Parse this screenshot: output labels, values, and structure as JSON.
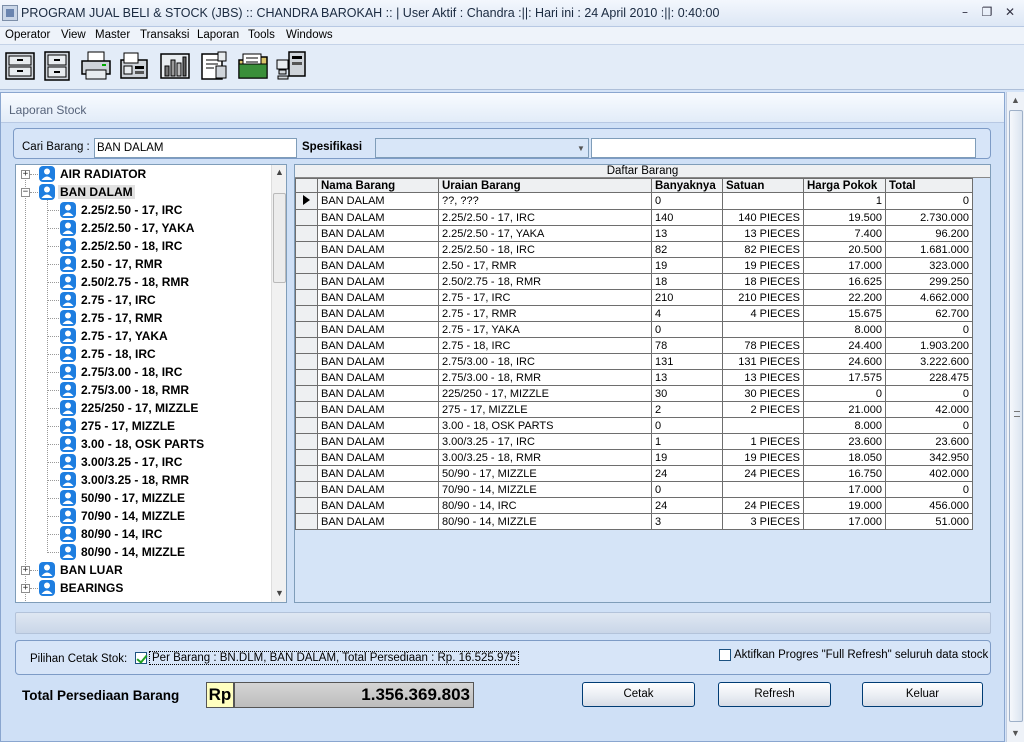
{
  "window": {
    "title": "PROGRAM JUAL BELI & STOCK (JBS) :: CHANDRA BAROKAH :: | User Aktif  : Chandra :||: Hari ini : 24 April 2010 :||: 0:40:00"
  },
  "menu": [
    {
      "label": "Operator"
    },
    {
      "label": "View"
    },
    {
      "label": "Master"
    },
    {
      "label": "Transaksi"
    },
    {
      "label": "Laporan"
    },
    {
      "label": "Tools"
    },
    {
      "label": "Windows"
    }
  ],
  "toolbar_icons": [
    "cabinet-icon",
    "cabinet-drawers-icon",
    "printer-icon",
    "fax-icon",
    "chart-icon",
    "report-icon",
    "folder-icon",
    "network-icon"
  ],
  "form": {
    "title": "Laporan Stock",
    "search_label": "Cari Barang :",
    "search_value": "BAN DALAM",
    "spec_label": "Spesifikasi",
    "spec_value": "",
    "spec_text": ""
  },
  "tree": {
    "root_items": [
      {
        "label": "AIR RADIATOR",
        "expanded": false
      },
      {
        "label": "BAN DALAM",
        "expanded": true,
        "selected": true
      },
      {
        "label": "BAN LUAR",
        "expanded": false
      },
      {
        "label": "BEARINGS",
        "expanded": false
      }
    ],
    "children": [
      "2.25/2.50 - 17, IRC",
      "2.25/2.50 - 17, YAKA",
      "2.25/2.50 - 18, IRC",
      "2.50 - 17, RMR",
      "2.50/2.75 - 18, RMR",
      "2.75 - 17, IRC",
      "2.75 - 17, RMR",
      "2.75 - 17, YAKA",
      "2.75 - 18, IRC",
      "2.75/3.00 - 18, IRC",
      "2.75/3.00 - 18, RMR",
      "225/250 - 17, MIZZLE",
      "275 - 17, MIZZLE",
      "3.00 - 18, OSK PARTS",
      "3.00/3.25 - 17, IRC",
      "3.00/3.25 - 18, RMR",
      "50/90 - 17, MIZZLE",
      "70/90 - 14, MIZZLE",
      "80/90 - 14, IRC",
      "80/90 - 14, MIZZLE"
    ]
  },
  "grid": {
    "caption": "Daftar Barang",
    "columns": [
      "Nama Barang",
      "Uraian Barang",
      "Banyaknya",
      "Satuan",
      "Harga Pokok",
      "Total"
    ],
    "rows": [
      [
        "BAN DALAM",
        "??, ???",
        "0",
        "",
        "1",
        "0"
      ],
      [
        "BAN DALAM",
        "2.25/2.50 - 17, IRC",
        "140",
        "140 PIECES",
        "19.500",
        "2.730.000"
      ],
      [
        "BAN DALAM",
        "2.25/2.50 - 17, YAKA",
        "13",
        "13 PIECES",
        "7.400",
        "96.200"
      ],
      [
        "BAN DALAM",
        "2.25/2.50 - 18, IRC",
        "82",
        "82 PIECES",
        "20.500",
        "1.681.000"
      ],
      [
        "BAN DALAM",
        "2.50 - 17, RMR",
        "19",
        "19 PIECES",
        "17.000",
        "323.000"
      ],
      [
        "BAN DALAM",
        "2.50/2.75 - 18, RMR",
        "18",
        "18 PIECES",
        "16.625",
        "299.250"
      ],
      [
        "BAN DALAM",
        "2.75 - 17, IRC",
        "210",
        "210 PIECES",
        "22.200",
        "4.662.000"
      ],
      [
        "BAN DALAM",
        "2.75 - 17, RMR",
        "4",
        "4 PIECES",
        "15.675",
        "62.700"
      ],
      [
        "BAN DALAM",
        "2.75 - 17, YAKA",
        "0",
        "",
        "8.000",
        "0"
      ],
      [
        "BAN DALAM",
        "2.75 - 18, IRC",
        "78",
        "78 PIECES",
        "24.400",
        "1.903.200"
      ],
      [
        "BAN DALAM",
        "2.75/3.00 - 18, IRC",
        "131",
        "131 PIECES",
        "24.600",
        "3.222.600"
      ],
      [
        "BAN DALAM",
        "2.75/3.00 - 18, RMR",
        "13",
        "13 PIECES",
        "17.575",
        "228.475"
      ],
      [
        "BAN DALAM",
        "225/250 - 17, MIZZLE",
        "30",
        "30 PIECES",
        "0",
        "0"
      ],
      [
        "BAN DALAM",
        "275 - 17, MIZZLE",
        "2",
        "2 PIECES",
        "21.000",
        "42.000"
      ],
      [
        "BAN DALAM",
        "3.00 - 18, OSK PARTS",
        "0",
        "",
        "8.000",
        "0"
      ],
      [
        "BAN DALAM",
        "3.00/3.25 - 17, IRC",
        "1",
        "1 PIECES",
        "23.600",
        "23.600"
      ],
      [
        "BAN DALAM",
        "3.00/3.25 - 18, RMR",
        "19",
        "19 PIECES",
        "18.050",
        "342.950"
      ],
      [
        "BAN DALAM",
        "50/90 - 17, MIZZLE",
        "24",
        "24 PIECES",
        "16.750",
        "402.000"
      ],
      [
        "BAN DALAM",
        "70/90 - 14, MIZZLE",
        "0",
        "",
        "17.000",
        "0"
      ],
      [
        "BAN DALAM",
        "80/90 - 14, IRC",
        "24",
        "24 PIECES",
        "19.000",
        "456.000"
      ],
      [
        "BAN DALAM",
        "80/90 - 14, MIZZLE",
        "3",
        "3 PIECES",
        "17.000",
        "51.000"
      ]
    ]
  },
  "print_options": {
    "label": "Pilihan Cetak Stok:",
    "per_barang_checked": true,
    "per_barang_label": "Per Barang : BN.DLM, BAN DALAM, Total Persediaan : Rp. 16.525.975",
    "full_refresh_checked": false,
    "full_refresh_label": "Aktifkan Progres \"Full  Refresh\" seluruh data stock"
  },
  "totals": {
    "label": "Total Persediaan Barang",
    "currency": "Rp",
    "value": "1.356.369.803"
  },
  "buttons": {
    "print": "Cetak",
    "refresh": "Refresh",
    "exit": "Keluar"
  },
  "colors": {
    "accent": "#7d9bc6",
    "panel": "#d7e5f8",
    "tree_icon": "#1e7ee0",
    "total_highlight": "#ffffc0"
  }
}
